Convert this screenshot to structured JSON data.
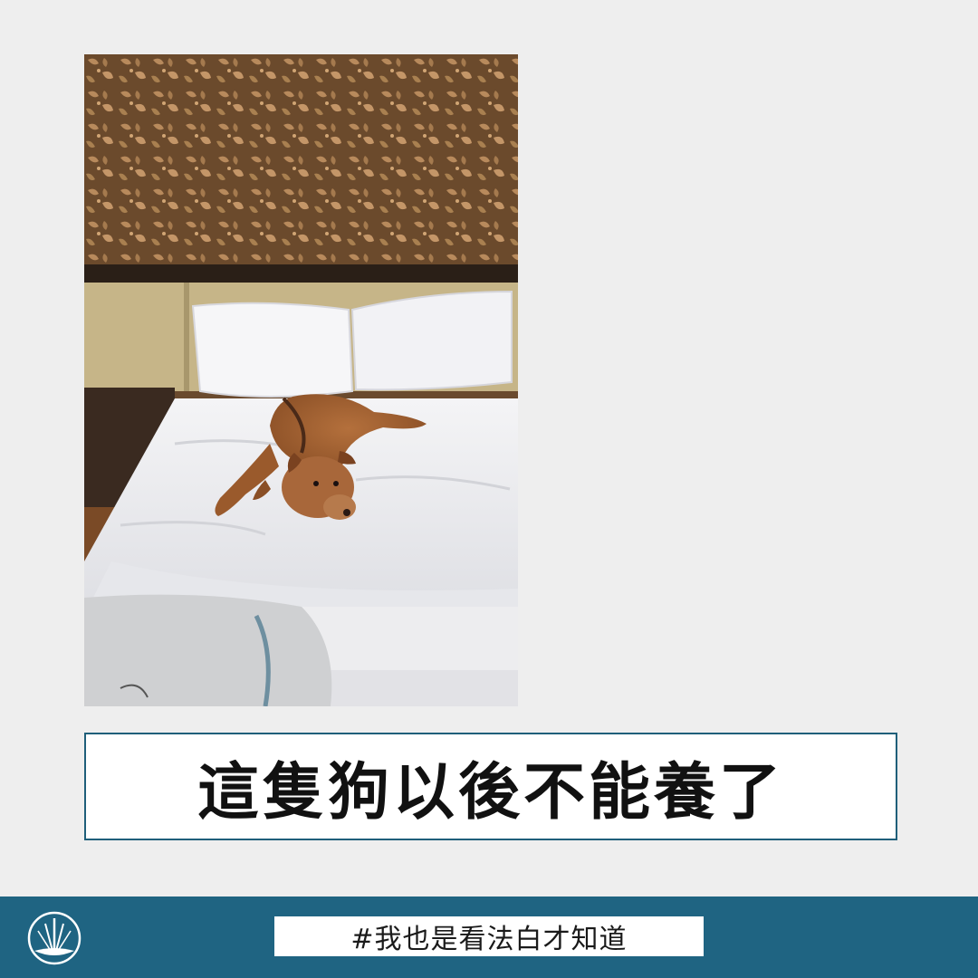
{
  "caption": {
    "text": "這隻狗以後不能養了"
  },
  "footer": {
    "hashtag": "#我也是看法白才知道",
    "logo_icon": "scales-justice-icon"
  },
  "photo": {
    "subject": "dog-lying-on-bed-image"
  },
  "colors": {
    "background": "#eeeeee",
    "accent": "#1f6482",
    "caption_border": "#1f5f7a"
  }
}
